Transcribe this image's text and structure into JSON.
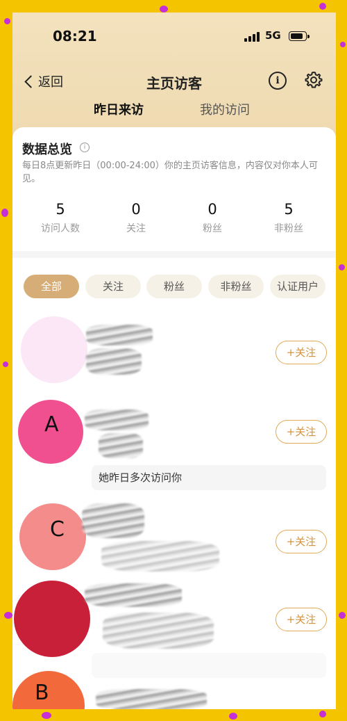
{
  "status_bar": {
    "time": "08:21",
    "network": "5G"
  },
  "nav": {
    "back_label": "返回",
    "title": "主页访客",
    "info_symbol": "i"
  },
  "tabs": [
    {
      "label": "昨日来访",
      "active": true
    },
    {
      "label": "我的访问",
      "active": false
    }
  ],
  "overview": {
    "title": "数据总览",
    "info_symbol": "i",
    "description": "每日8点更新昨日（00:00-24:00）你的主页访客信息，内容仅对你本人可见。",
    "stats": [
      {
        "value": "5",
        "label": "访问人数"
      },
      {
        "value": "0",
        "label": "关注"
      },
      {
        "value": "0",
        "label": "粉丝"
      },
      {
        "value": "5",
        "label": "非粉丝"
      }
    ]
  },
  "filters": [
    {
      "label": "全部",
      "active": true
    },
    {
      "label": "关注",
      "active": false
    },
    {
      "label": "粉丝",
      "active": false
    },
    {
      "label": "非粉丝",
      "active": false
    },
    {
      "label": "认证用户",
      "active": false
    }
  ],
  "visitors": [
    {
      "avatar_letter": "",
      "avatar_color": "#fbe7f6",
      "follow_label": "+关注",
      "note": ""
    },
    {
      "avatar_letter": "A",
      "avatar_color": "#f0508f",
      "follow_label": "+关注",
      "note": "她昨日多次访问你"
    },
    {
      "avatar_letter": "C",
      "avatar_color": "#f58c8c",
      "follow_label": "+关注",
      "note": ""
    },
    {
      "avatar_letter": "",
      "avatar_color": "#c9203a",
      "follow_label": "+关注",
      "note": ""
    },
    {
      "avatar_letter": "B",
      "avatar_color": "#f26a3c",
      "follow_label": "",
      "note": ""
    }
  ],
  "colors": {
    "accent": "#d6ad76",
    "follow_text": "#d4923a",
    "frame_yellow": "#f5c400",
    "confetti": "#c62fd6"
  }
}
